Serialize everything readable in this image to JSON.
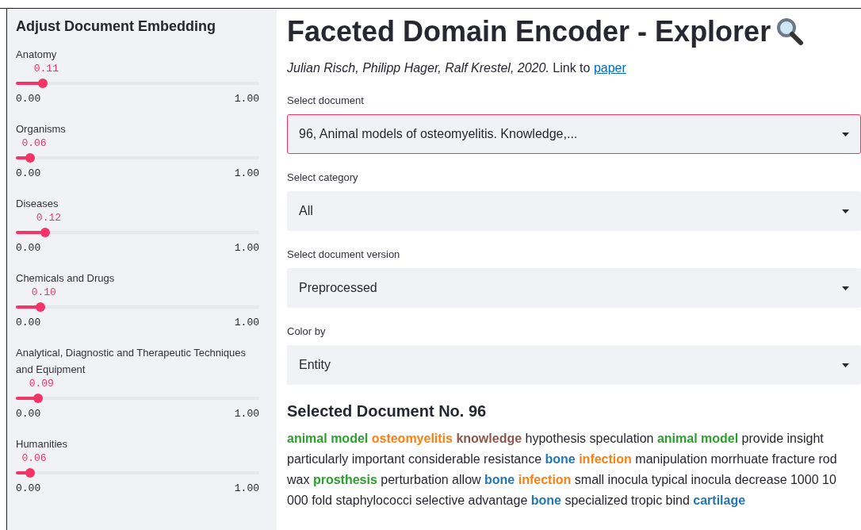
{
  "sidebar": {
    "title": "Adjust Document Embedding",
    "sliders": [
      {
        "label": "Anatomy",
        "level": 0.11,
        "reading": "0.11",
        "min": "0.00",
        "max": "1.00"
      },
      {
        "label": "Organisms",
        "level": 0.06,
        "reading": "0.06",
        "min": "0.00",
        "max": "1.00"
      },
      {
        "label": "Diseases",
        "level": 0.12,
        "reading": "0.12",
        "min": "0.00",
        "max": "1.00"
      },
      {
        "label": "Chemicals and Drugs",
        "level": 0.1,
        "reading": "0.10",
        "min": "0.00",
        "max": "1.00"
      },
      {
        "label": "Analytical, Diagnostic and Therapeutic Techniques and Equipment",
        "level": 0.09,
        "reading": "0.09",
        "min": "0.00",
        "max": "1.00"
      },
      {
        "label": "Humanities",
        "level": 0.06,
        "reading": "0.06",
        "min": "0.00",
        "max": "1.00"
      }
    ]
  },
  "main": {
    "title": "Faceted Domain Encoder - Explorer",
    "byline": {
      "authors": "Julian Risch, Philipp Hager, Ralf Krestel, 2020.",
      "link_prefix": "Link to",
      "link": "paper"
    },
    "selects": [
      {
        "label": "Select document",
        "value": "96, Animal models of osteomyelitis. Knowledge,...",
        "focused": true
      },
      {
        "label": "Select category",
        "value": "All",
        "focused": false
      },
      {
        "label": "Select document version",
        "value": "Preprocessed",
        "focused": false
      },
      {
        "label": "Color by",
        "value": "Entity",
        "focused": false
      }
    ],
    "document": {
      "heading": "Selected Document No. 96",
      "tokens": [
        {
          "kind": "entity",
          "text": "animal model",
          "color": "#2ca02c"
        },
        {
          "kind": "entity",
          "text": "osteomyelitis",
          "color": "#ff7f0e"
        },
        {
          "kind": "entity",
          "text": "knowledge",
          "color": "#8c564b"
        },
        {
          "kind": "plain",
          "text": "hypothesis speculation"
        },
        {
          "kind": "entity",
          "text": "animal model",
          "color": "#2ca02c"
        },
        {
          "kind": "plain",
          "text": "provide insight particularly important considerable resistance"
        },
        {
          "kind": "entity",
          "text": "bone",
          "color": "#1f77b4"
        },
        {
          "kind": "entity",
          "text": "infection",
          "color": "#ff7f0e"
        },
        {
          "kind": "plain",
          "text": "manipulation morrhuate fracture rod wax"
        },
        {
          "kind": "entity",
          "text": "prosthesis",
          "color": "#2ca02c"
        },
        {
          "kind": "plain",
          "text": "perturbation allow"
        },
        {
          "kind": "entity",
          "text": "bone",
          "color": "#1f77b4"
        },
        {
          "kind": "entity",
          "text": "infection",
          "color": "#ff7f0e"
        },
        {
          "kind": "plain",
          "text": "small inocula typical inocula decrease 1000 10 000 fold staphylococci selective advantage"
        },
        {
          "kind": "entity",
          "text": "bone",
          "color": "#1f77b4"
        },
        {
          "kind": "plain",
          "text": "specialized tropic bind"
        },
        {
          "kind": "entity",
          "text": "cartilage",
          "color": "#1f77b4"
        }
      ]
    }
  }
}
